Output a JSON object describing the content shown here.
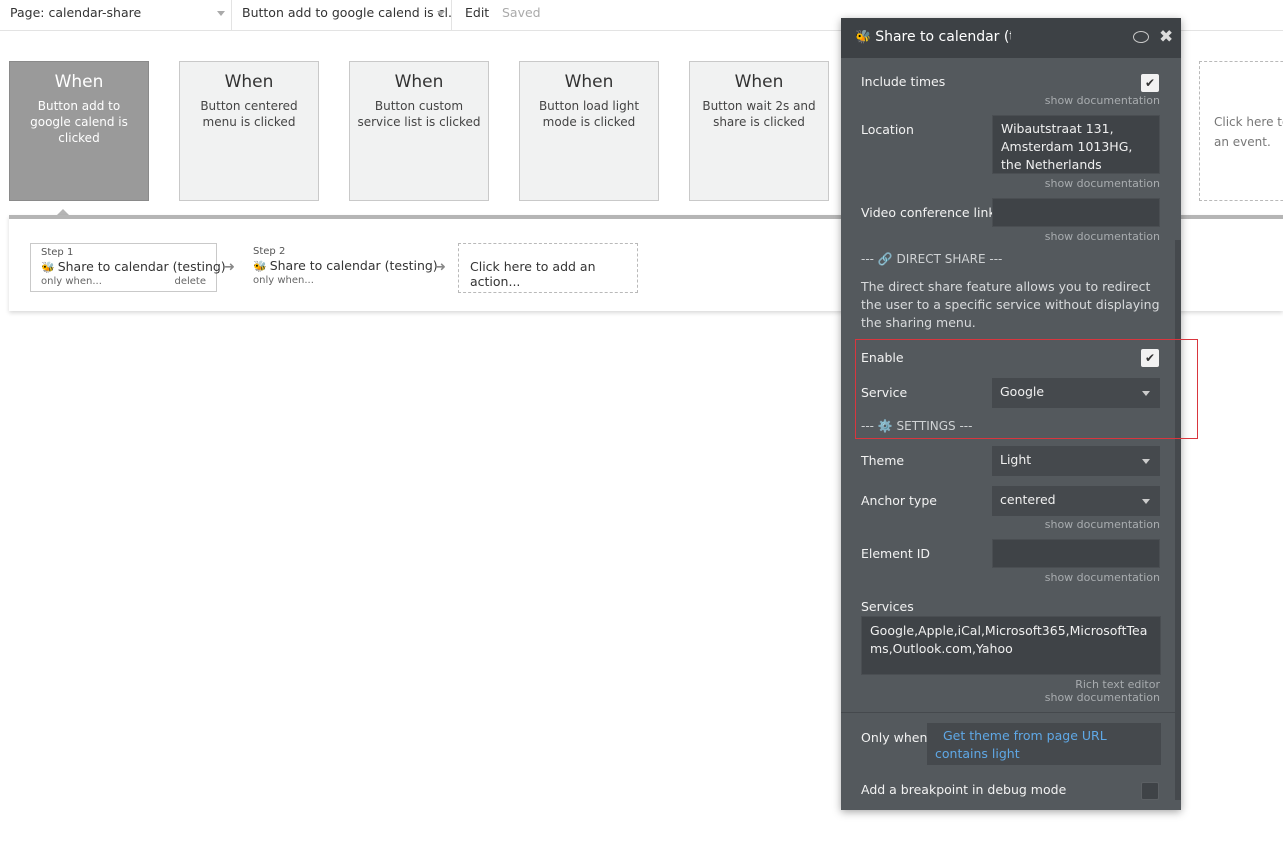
{
  "topbar": {
    "page_select": "Page: calendar-share",
    "event_select": "Button add to google calend is cl...",
    "edit": "Edit",
    "saved": "Saved"
  },
  "events": [
    {
      "when": "When",
      "desc": "Button add to google calend is clicked",
      "selected": true
    },
    {
      "when": "When",
      "desc": "Button centered menu is clicked",
      "selected": false
    },
    {
      "when": "When",
      "desc": "Button custom service list is clicked",
      "selected": false
    },
    {
      "when": "When",
      "desc": "Button load light mode is clicked",
      "selected": false
    },
    {
      "when": "When",
      "desc": "Button wait 2s and share is clicked",
      "selected": false
    }
  ],
  "add_event": "Click here to add an event.",
  "steps": [
    {
      "label": "Step 1",
      "name": "Share to calendar (testing)",
      "only_when": "only when...",
      "delete": "delete"
    },
    {
      "label": "Step 2",
      "name": "Share to calendar (testing)",
      "only_when": "only when..."
    }
  ],
  "add_action": "Click here to add an action...",
  "panel": {
    "title": "Share to calendar (te:",
    "include_times_label": "Include times",
    "show_doc": "show documentation",
    "location_label": "Location",
    "location_value": "Wibautstraat 131, Amsterdam 1013HG, the Netherlands",
    "video_label": "Video conference link",
    "direct_share_section": "--- 🔗 DIRECT SHARE ---",
    "direct_share_desc": "The direct share feature allows you to redirect the user to a specific service without displaying the sharing menu.",
    "enable_label": "Enable",
    "service_label": "Service",
    "service_value": "Google",
    "settings_section": "--- ⚙️ SETTINGS ---",
    "theme_label": "Theme",
    "theme_value": "Light",
    "anchor_label": "Anchor type",
    "anchor_value": "centered",
    "element_id_label": "Element ID",
    "services_label": "Services",
    "services_value": "Google,Apple,iCal,Microsoft365,MicrosoftTeams,Outlook.com,Yahoo",
    "rich_text": "Rich text editor",
    "only_when_label": "Only when",
    "only_when_value": "Get theme from page URL contains light",
    "breakpoint_label": "Add a breakpoint in debug mode",
    "include_times_checked": true,
    "enable_checked": true,
    "breakpoint_checked": false
  },
  "colors": {
    "panel_bg": "#54595d",
    "panel_header": "#3d4145",
    "link_blue": "#5fa8e6",
    "highlight_red": "#d9363e",
    "selected_event": "#9a9a9a"
  }
}
